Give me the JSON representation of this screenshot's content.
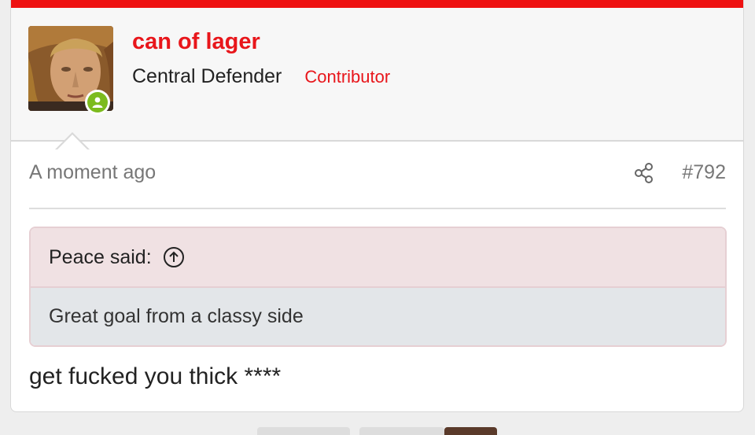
{
  "colors": {
    "accent": "#e8161b",
    "online": "#7cbb1e",
    "quote_head_bg": "#f0e1e3",
    "quote_body_bg": "#e3e6e9"
  },
  "post": {
    "author": {
      "username": "can of lager",
      "title": "Central Defender",
      "badge": "Contributor",
      "avatar_icon": "avatar-portrait",
      "status_icon": "online-user-icon"
    },
    "time": "A moment ago",
    "share_icon": "share-icon",
    "number": "#792",
    "quote": {
      "attribution": "Peace said:",
      "jump_icon": "arrow-up-circle-icon",
      "text": "Great goal from a classy side"
    },
    "message": "get fucked you thick ****"
  }
}
